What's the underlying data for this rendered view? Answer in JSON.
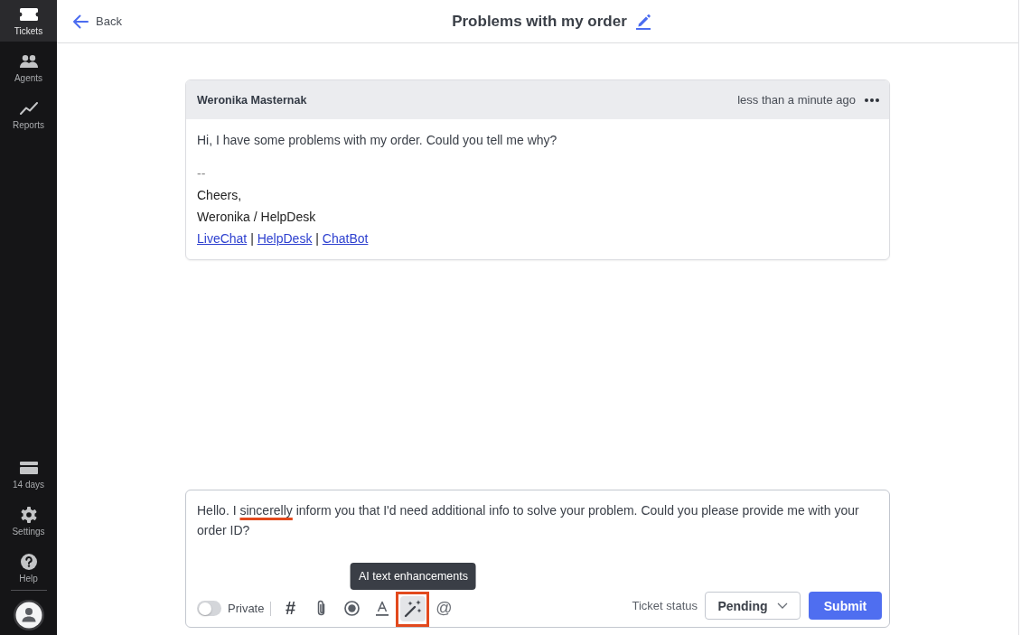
{
  "sidebar": {
    "top_items": [
      {
        "kind": "ticket",
        "label": "Tickets",
        "selected": true
      },
      {
        "kind": "agents",
        "label": "Agents",
        "selected": false
      },
      {
        "kind": "reports",
        "label": "Reports",
        "selected": false
      }
    ],
    "bottom_items": [
      {
        "kind": "trial",
        "label": "14 days",
        "selected": false
      },
      {
        "kind": "settings",
        "label": "Settings",
        "selected": false
      },
      {
        "kind": "help",
        "label": "Help",
        "selected": false
      }
    ]
  },
  "header": {
    "back_label": "Back",
    "title": "Problems with my order"
  },
  "message": {
    "author": "Weronika Masternak",
    "time": "less than a minute ago",
    "body": "Hi, I have some problems with my order. Could you tell me why?",
    "signature": {
      "separator": "--",
      "lines": [
        "Cheers,",
        "Weronika / HelpDesk"
      ],
      "links": [
        {
          "kind": "link",
          "text": "LiveChat"
        },
        {
          "kind": "separator",
          "text": "|"
        },
        {
          "kind": "link",
          "text": "HelpDesk"
        },
        {
          "kind": "separator",
          "text": "|"
        },
        {
          "kind": "link",
          "text": "ChatBot"
        }
      ]
    }
  },
  "composer": {
    "segments": [
      {
        "text": "Hello. I ",
        "flagged": false
      },
      {
        "text": "sincerelly",
        "flagged": true
      },
      {
        "text": " inform you that I'd need additional info to solve your problem. Could you please provide me with your order ID?",
        "flagged": false
      }
    ],
    "private": {
      "label": "Private",
      "on": false
    },
    "tools": [
      {
        "kind": "hash",
        "glyph": "#",
        "hovered": false,
        "highlighted": false
      },
      {
        "kind": "attach",
        "hovered": false,
        "highlighted": false
      },
      {
        "kind": "record",
        "hovered": false,
        "highlighted": false
      },
      {
        "kind": "text-color",
        "hovered": false,
        "highlighted": false
      },
      {
        "kind": "ai-wand",
        "hovered": true,
        "highlighted": true,
        "tooltip": "AI text enhancements"
      },
      {
        "kind": "mention",
        "glyph": "@",
        "hovered": false,
        "highlighted": false
      }
    ],
    "status_label": "Ticket status",
    "status": "Pending",
    "submit": "Submit"
  }
}
